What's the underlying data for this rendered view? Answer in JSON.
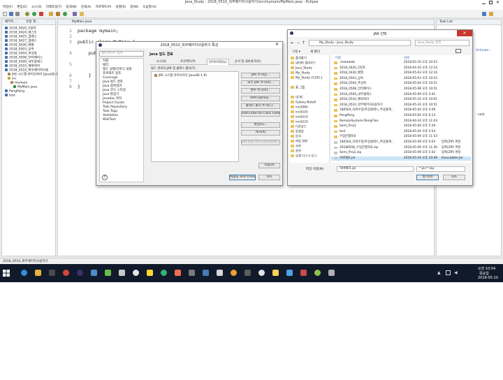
{
  "window": {
    "title": "Java_Study - 2018_0510_외부패키지사용하기/src/mymain/MyMain.java - Eclipse"
  },
  "menu": [
    "파일(F)",
    "편집(E)",
    "소스(S)",
    "리팩토링(T)",
    "탐색(N)",
    "검색(A)",
    "프로젝트(P)",
    "실행(R)",
    "창(W)",
    "도움말(H)"
  ],
  "explorer": {
    "tabs": [
      "패키지 ...",
      "유형 계..."
    ],
    "items": [
      "2018_0420_5일차",
      "2018_0424_레스트",
      "2018_0425_클래스",
      "2018_0427_클래스",
      "2018_0430_배열",
      "2018_0503_상속",
      "2018_0504_추상화",
      "2018_0508_인터페이스",
      "2018_0509_내부클래스",
      "2018_0510_예외처리",
      "2018_0510_외부패키지사용",
      "JRE 시스템 라이브러리 [JavaSE-1.8]",
      "src",
      "mymain",
      "MyMain.java",
      "PangPang",
      "test"
    ]
  },
  "editor": {
    "tab": "MyMain.java",
    "lines": [
      "package mymain;",
      "",
      "public class MyMain {",
      "    pub",
      "",
      "    }",
      "",
      "}"
    ],
    "line_numbers": [
      "1",
      "2",
      "3",
      "4",
      "5",
      "6",
      "7",
      "8"
    ]
  },
  "right_panel": {
    "tab": "Task List",
    "activate": "Activate...",
    "void_label": ": void"
  },
  "status_bar": {
    "text": "2018_0510_외부패키지사용하기"
  },
  "properties_dialog": {
    "title": "2018_0510_외부패키지사용하기 특성",
    "filter_placeholder": "필터 텍스트 입력",
    "heading": "Java 빌드 경로",
    "categories": [
      "자원",
      "빌더",
      "빌드 실행/디버그 설정",
      "프로젝트 참조",
      "Coverage",
      "Java 빌드 경로",
      "Java 컴파일러",
      "Java 코드 스타일",
      "Java 편집기",
      "Javadoc 위치",
      "Project Facets",
      "Task Repository",
      "Task Tags",
      "Validation",
      "WikiText"
    ],
    "tabs": [
      "소스(S)",
      "프로젝트(P)",
      "라이브러리(L)",
      "순서 및 내보내기(O)"
    ],
    "desc": "빌드 경로의 JAR 및 클래스 폴더(T):",
    "lib_item": "JRE 시스템 라이브러리 [JavaSE-1.8]",
    "buttons": [
      "JAR 추가(J)...",
      "외부 JAR 추가(X)...",
      "변수 추가(V)...",
      "Add Library...",
      "클래스 폴더 추가(C)...",
      "Add External Class Folder..."
    ],
    "edit_buttons": [
      "편집(E)...",
      "제거(R)",
      "JAR 파일 마이그레이션(M)..."
    ],
    "apply": "적용(A)",
    "apply_close": "Apply and Close",
    "cancel": "취소"
  },
  "jar_dialog": {
    "title": "JAR 선택",
    "breadcrumb": [
      "My_Study",
      "Java_Study"
    ],
    "search_placeholder": "Java_Study 검색",
    "organize": "구성 ▾",
    "new_folder": "새 폴더",
    "col_name": "이름",
    "col_date": "날짜",
    "nav_items": [
      "즐겨찾기",
      "네이버 클라우드",
      "Java_Study",
      "My_Study",
      "My_Study (\\\\192.1",
      "",
      "홈 그룹",
      "",
      "내 PC",
      "Galaxy Note6",
      "inc(b06)",
      "inc(b10)",
      "inc(b13)",
      "inc(b13)",
      "다운로드",
      "동영상",
      "문서",
      "바탕 화면",
      "사진",
      "음악",
      "로컬 디스크 (C:)"
    ],
    "files": [
      {
        "name": ".metadata",
        "date": "2018-05-10 오후 10:53",
        "type": ""
      },
      {
        "name": "2018_0420_5일차",
        "date": "2018-04-20 오후 12:14",
        "type": ""
      },
      {
        "name": "2018_0430_배열",
        "date": "2018-05-03 오후 12:16",
        "type": ""
      },
      {
        "name": "2018_0503_상속",
        "date": "2018-05-03 오후 10:53",
        "type": ""
      },
      {
        "name": "2018_0504_추상화",
        "date": "2018-05-04 오후 10:51",
        "type": ""
      },
      {
        "name": "2018_0508_인터페이스",
        "date": "2018-05-08 오후 10:51",
        "type": ""
      },
      {
        "name": "2018_0509_내부클래스",
        "date": "2018-05-09 오후 3:41",
        "type": ""
      },
      {
        "name": "2018_0510_예외처리",
        "date": "2018-05-10 오후 10:01",
        "type": ""
      },
      {
        "name": "2018_0510_외부패키지사용하기",
        "date": "2018-05-10 오후 10:51",
        "type": ""
      },
      {
        "name": "180504_자바수업(추상클래스_추상클래...",
        "date": "2018-05-04 오후 4:49",
        "type": ""
      },
      {
        "name": "PangPang",
        "date": "2018-05-04 오후 6:13",
        "type": ""
      },
      {
        "name": "RemoteSystemsTempFiles",
        "date": "2018-04-24 오후 11:03",
        "type": ""
      },
      {
        "name": "Semi_Proj1",
        "date": "2018-05-09 오후 5:39",
        "type": ""
      },
      {
        "name": "test",
        "date": "2018-05-04 오후 5:54",
        "type": ""
      },
      {
        "name": "수업진행자료",
        "date": "2018-05-09 오후 11:53",
        "type": ""
      },
      {
        "name": "180504_자바수업(추상클래스_추상클래...",
        "date": "2018-05-09 오후 4:03",
        "type": "압축(ZIP) 파일"
      },
      {
        "name": "20180508_수업진행자료.zip",
        "date": "2018-05-09 오후 11:30",
        "type": "압축(ZIP) 파일"
      },
      {
        "name": "Semi_Proj1.zip",
        "date": "2018-05-09 오후 5:43",
        "type": "압축(ZIP) 파일"
      },
      {
        "name": "자바패포.jar",
        "date": "2018-05-10 오후 10:49",
        "type": "Executable Jar"
      }
    ],
    "filename_label": "파일 이름(N):",
    "filename_value": "자바패포.jar",
    "filter_value": "*.jar;*.zip",
    "open": "열기(O)",
    "cancel": "취소"
  },
  "taskbar": {
    "time": "오전 10:54",
    "day": "목요일",
    "date": "2018-05-10"
  }
}
